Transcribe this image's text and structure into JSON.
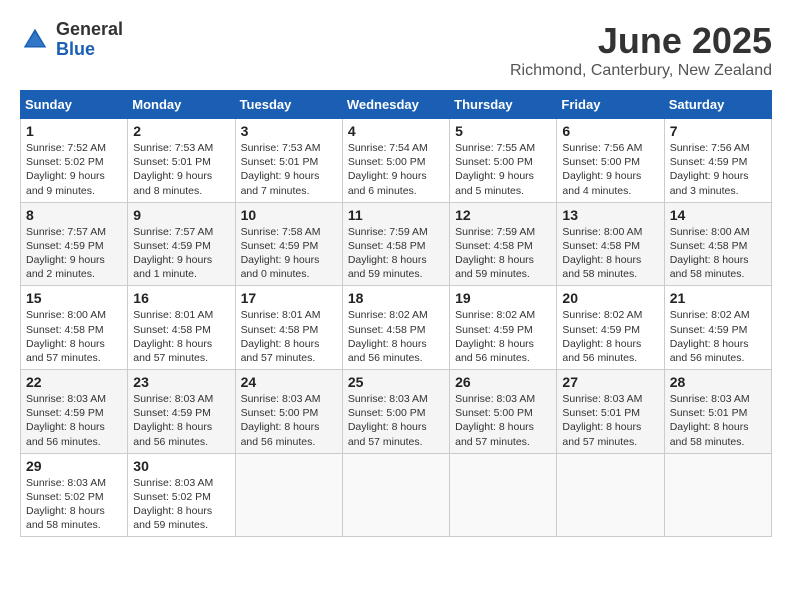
{
  "logo": {
    "general": "General",
    "blue": "Blue"
  },
  "title": "June 2025",
  "subtitle": "Richmond, Canterbury, New Zealand",
  "days_of_week": [
    "Sunday",
    "Monday",
    "Tuesday",
    "Wednesday",
    "Thursday",
    "Friday",
    "Saturday"
  ],
  "weeks": [
    [
      {
        "day": "1",
        "sunrise": "7:52 AM",
        "sunset": "5:02 PM",
        "daylight": "9 hours and 9 minutes."
      },
      {
        "day": "2",
        "sunrise": "7:53 AM",
        "sunset": "5:01 PM",
        "daylight": "9 hours and 8 minutes."
      },
      {
        "day": "3",
        "sunrise": "7:53 AM",
        "sunset": "5:01 PM",
        "daylight": "9 hours and 7 minutes."
      },
      {
        "day": "4",
        "sunrise": "7:54 AM",
        "sunset": "5:00 PM",
        "daylight": "9 hours and 6 minutes."
      },
      {
        "day": "5",
        "sunrise": "7:55 AM",
        "sunset": "5:00 PM",
        "daylight": "9 hours and 5 minutes."
      },
      {
        "day": "6",
        "sunrise": "7:56 AM",
        "sunset": "5:00 PM",
        "daylight": "9 hours and 4 minutes."
      },
      {
        "day": "7",
        "sunrise": "7:56 AM",
        "sunset": "4:59 PM",
        "daylight": "9 hours and 3 minutes."
      }
    ],
    [
      {
        "day": "8",
        "sunrise": "7:57 AM",
        "sunset": "4:59 PM",
        "daylight": "9 hours and 2 minutes."
      },
      {
        "day": "9",
        "sunrise": "7:57 AM",
        "sunset": "4:59 PM",
        "daylight": "9 hours and 1 minute."
      },
      {
        "day": "10",
        "sunrise": "7:58 AM",
        "sunset": "4:59 PM",
        "daylight": "9 hours and 0 minutes."
      },
      {
        "day": "11",
        "sunrise": "7:59 AM",
        "sunset": "4:58 PM",
        "daylight": "8 hours and 59 minutes."
      },
      {
        "day": "12",
        "sunrise": "7:59 AM",
        "sunset": "4:58 PM",
        "daylight": "8 hours and 59 minutes."
      },
      {
        "day": "13",
        "sunrise": "8:00 AM",
        "sunset": "4:58 PM",
        "daylight": "8 hours and 58 minutes."
      },
      {
        "day": "14",
        "sunrise": "8:00 AM",
        "sunset": "4:58 PM",
        "daylight": "8 hours and 58 minutes."
      }
    ],
    [
      {
        "day": "15",
        "sunrise": "8:00 AM",
        "sunset": "4:58 PM",
        "daylight": "8 hours and 57 minutes."
      },
      {
        "day": "16",
        "sunrise": "8:01 AM",
        "sunset": "4:58 PM",
        "daylight": "8 hours and 57 minutes."
      },
      {
        "day": "17",
        "sunrise": "8:01 AM",
        "sunset": "4:58 PM",
        "daylight": "8 hours and 57 minutes."
      },
      {
        "day": "18",
        "sunrise": "8:02 AM",
        "sunset": "4:58 PM",
        "daylight": "8 hours and 56 minutes."
      },
      {
        "day": "19",
        "sunrise": "8:02 AM",
        "sunset": "4:59 PM",
        "daylight": "8 hours and 56 minutes."
      },
      {
        "day": "20",
        "sunrise": "8:02 AM",
        "sunset": "4:59 PM",
        "daylight": "8 hours and 56 minutes."
      },
      {
        "day": "21",
        "sunrise": "8:02 AM",
        "sunset": "4:59 PM",
        "daylight": "8 hours and 56 minutes."
      }
    ],
    [
      {
        "day": "22",
        "sunrise": "8:03 AM",
        "sunset": "4:59 PM",
        "daylight": "8 hours and 56 minutes."
      },
      {
        "day": "23",
        "sunrise": "8:03 AM",
        "sunset": "4:59 PM",
        "daylight": "8 hours and 56 minutes."
      },
      {
        "day": "24",
        "sunrise": "8:03 AM",
        "sunset": "5:00 PM",
        "daylight": "8 hours and 56 minutes."
      },
      {
        "day": "25",
        "sunrise": "8:03 AM",
        "sunset": "5:00 PM",
        "daylight": "8 hours and 57 minutes."
      },
      {
        "day": "26",
        "sunrise": "8:03 AM",
        "sunset": "5:00 PM",
        "daylight": "8 hours and 57 minutes."
      },
      {
        "day": "27",
        "sunrise": "8:03 AM",
        "sunset": "5:01 PM",
        "daylight": "8 hours and 57 minutes."
      },
      {
        "day": "28",
        "sunrise": "8:03 AM",
        "sunset": "5:01 PM",
        "daylight": "8 hours and 58 minutes."
      }
    ],
    [
      {
        "day": "29",
        "sunrise": "8:03 AM",
        "sunset": "5:02 PM",
        "daylight": "8 hours and 58 minutes."
      },
      {
        "day": "30",
        "sunrise": "8:03 AM",
        "sunset": "5:02 PM",
        "daylight": "8 hours and 59 minutes."
      },
      null,
      null,
      null,
      null,
      null
    ]
  ]
}
